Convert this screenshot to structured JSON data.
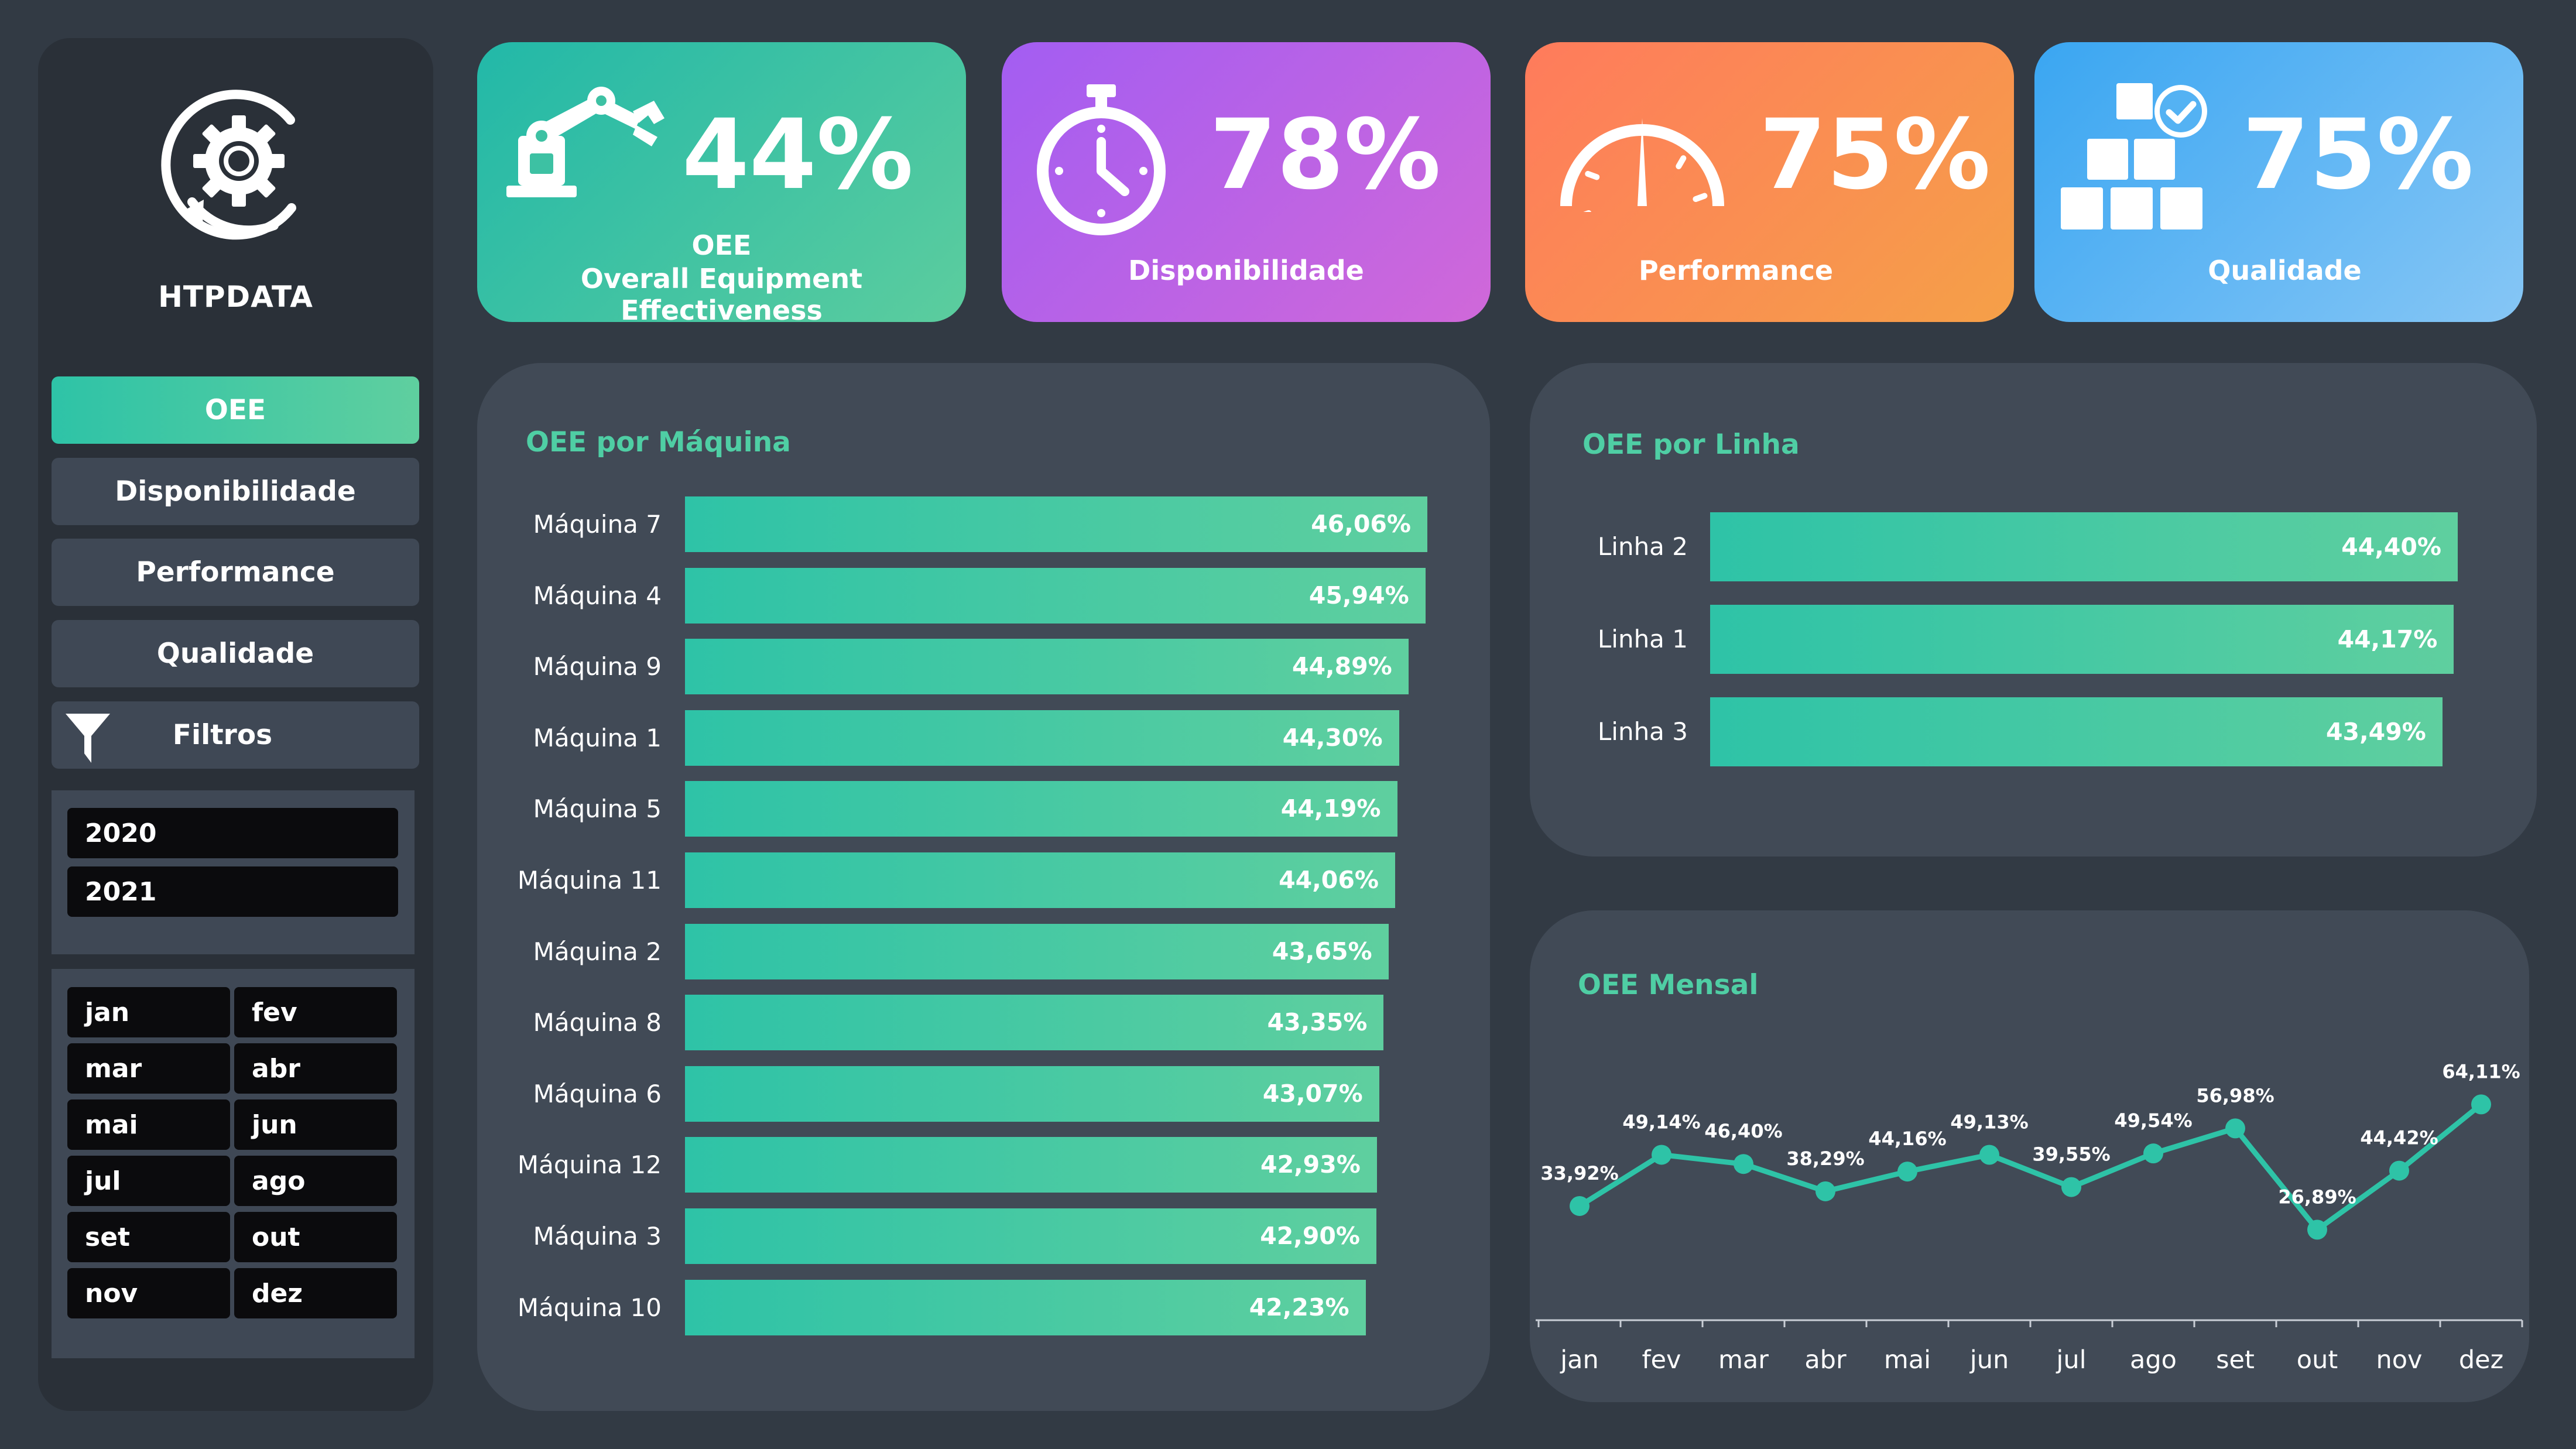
{
  "brand": {
    "name": "HTPDATA",
    "icon": "gear-refresh-icon"
  },
  "nav": [
    {
      "label": "OEE",
      "active": true
    },
    {
      "label": "Disponibilidade",
      "active": false
    },
    {
      "label": "Performance",
      "active": false
    },
    {
      "label": "Qualidade",
      "active": false
    }
  ],
  "filters": {
    "label": "Filtros",
    "icon": "funnel-icon",
    "years": [
      "2020",
      "2021"
    ],
    "months": [
      "jan",
      "fev",
      "mar",
      "abr",
      "mai",
      "jun",
      "jul",
      "ago",
      "set",
      "out",
      "nov",
      "dez"
    ]
  },
  "kpis": [
    {
      "value": "44%",
      "label": "OEE",
      "sublabel": "Overall Equipment Effectiveness",
      "icon": "robot-arm-icon"
    },
    {
      "value": "78%",
      "label": "Disponibilidade",
      "icon": "stopwatch-icon"
    },
    {
      "value": "75%",
      "label": "Performance",
      "icon": "speedometer-icon"
    },
    {
      "value": "75%",
      "label": "Qualidade",
      "icon": "boxes-check-icon"
    }
  ],
  "colors": {
    "background": "#323a44",
    "panel": "#414a56",
    "accent": "#4fcea4",
    "bar": "#2ec3a7"
  },
  "chart_data": [
    {
      "type": "bar",
      "orientation": "horizontal",
      "title": "OEE por Máquina",
      "categories": [
        "Máquina 7",
        "Máquina 4",
        "Máquina 9",
        "Máquina 1",
        "Máquina 5",
        "Máquina 11",
        "Máquina 2",
        "Máquina 8",
        "Máquina 6",
        "Máquina 12",
        "Máquina 3",
        "Máquina 10"
      ],
      "values": [
        46.06,
        45.94,
        44.89,
        44.3,
        44.19,
        44.06,
        43.65,
        43.35,
        43.07,
        42.93,
        42.9,
        42.23
      ],
      "value_labels": [
        "46,06%",
        "45,94%",
        "44,89%",
        "44,30%",
        "44,19%",
        "44,06%",
        "43,65%",
        "43,35%",
        "43,07%",
        "42,93%",
        "42,90%",
        "42,23%"
      ]
    },
    {
      "type": "bar",
      "orientation": "horizontal",
      "title": "OEE por Linha",
      "categories": [
        "Linha 2",
        "Linha 1",
        "Linha 3"
      ],
      "values": [
        44.4,
        44.17,
        43.49
      ],
      "value_labels": [
        "44,40%",
        "44,17%",
        "43,49%"
      ]
    },
    {
      "type": "line",
      "title": "OEE Mensal",
      "categories": [
        "jan",
        "fev",
        "mar",
        "abr",
        "mai",
        "jun",
        "jul",
        "ago",
        "set",
        "out",
        "nov",
        "dez"
      ],
      "values": [
        33.92,
        49.14,
        46.4,
        38.29,
        44.16,
        49.13,
        39.55,
        49.54,
        56.98,
        26.89,
        44.42,
        64.11
      ],
      "value_labels": [
        "33,92%",
        "49,14%",
        "46,40%",
        "38,29%",
        "44,16%",
        "49,13%",
        "39,55%",
        "49,54%",
        "56,98%",
        "26,89%",
        "44,42%",
        "64,11%"
      ]
    }
  ]
}
